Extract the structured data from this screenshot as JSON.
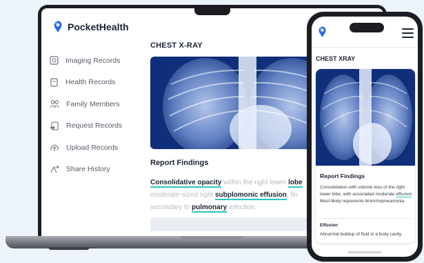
{
  "brand": {
    "name": "PocketHealth",
    "accent": "#2a6ee8",
    "highlight": "#26c6c1"
  },
  "sidebar": {
    "items": [
      {
        "label": "Imaging Records",
        "icon": "imaging-icon"
      },
      {
        "label": "Health Records",
        "icon": "document-icon"
      },
      {
        "label": "Family Members",
        "icon": "people-icon"
      },
      {
        "label": "Request Records",
        "icon": "request-icon"
      },
      {
        "label": "Upload Records",
        "icon": "upload-icon"
      },
      {
        "label": "Share History",
        "icon": "share-icon"
      }
    ]
  },
  "desktop": {
    "section_title": "CHEST X-RAY",
    "findings_title": "Report Findings",
    "findings": {
      "t1": "Consolidative opacity",
      "t2": " within the right lower ",
      "t3": "lobe",
      "t4": "moderate-sized right ",
      "t5": "subplomonic effusion",
      "t6": ", fin",
      "t7": "secondary to ",
      "t8": "pulmonary",
      "t9": " infection."
    }
  },
  "phone": {
    "section_title": "CHEST XRAY",
    "findings_title": "Report Findings",
    "findings_a": "Consolidation with volume loss of the right lower lobe, with associated moderate ",
    "findings_link": "effusion",
    "findings_b": ". Most likely represents bronchopneumonia.",
    "term_title": "Effusion",
    "term_text": "Abnormal buildup of fluid in a body cavity."
  }
}
